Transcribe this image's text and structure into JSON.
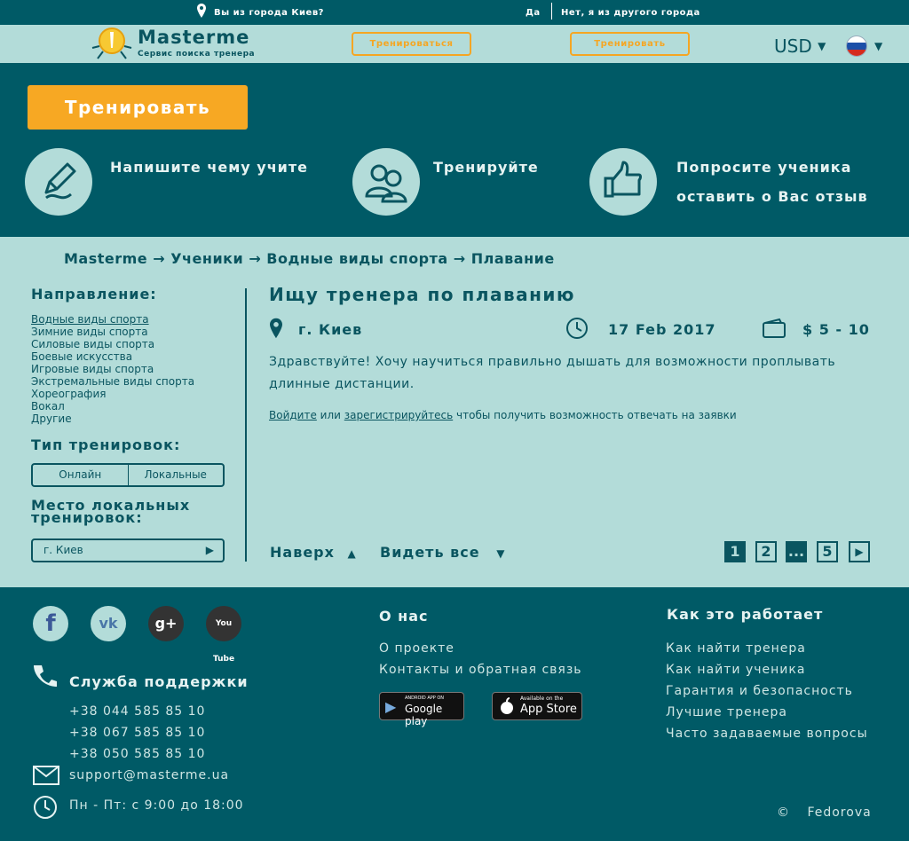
{
  "topbar": {
    "question": "Вы из города Киев?",
    "yes": "Да",
    "no": "Нет, я из другого города"
  },
  "header": {
    "logo_title": "Masterme",
    "logo_subtitle": "Сервис поиска тренера",
    "btn1": "Тренироваться",
    "btn2": "Тренировать",
    "currency": "USD"
  },
  "hero": {
    "cta": "Тренировать",
    "steps": [
      {
        "icon": "pencil-icon",
        "text": "Напишите чему учите"
      },
      {
        "icon": "users-icon",
        "text": "Тренируйте"
      },
      {
        "icon": "thumbs-up-icon",
        "text_line1": "Попросите ученика",
        "text_line2": "оставить о Вас отзыв"
      }
    ]
  },
  "breadcrumb": [
    "Masterme",
    "Ученики",
    "Водные виды спорта",
    "Плавание"
  ],
  "sidebar": {
    "direction_title": "Направление:",
    "directions": [
      "Водные виды спорта",
      "Зимние виды спорта",
      "Силовые виды спорта",
      "Боевые искусства",
      "Игровые виды спорта",
      "Экстремальные виды спорта",
      "Хореография",
      "Вокал",
      "Другие"
    ],
    "type_title": "Тип тренировок:",
    "type_options": [
      "Онлайн",
      "Локальные"
    ],
    "place_title_line1": "Место локальных",
    "place_title_line2": "тренировок:",
    "city_value": "г. Киев"
  },
  "request": {
    "title": "Ищу тренера по плаванию",
    "city": "г. Киев",
    "date": "17 Feb 2017",
    "price": "$ 5 - 10",
    "description": "Здравствуйте! Хочу научиться правильно дышать для возможности проплывать длинные дистанции.",
    "login_link": "Войдите",
    "or": "или",
    "register_link": "зарегистрируйтесь",
    "note_rest": "чтобы получить возможность отвечать на заявки"
  },
  "nav": {
    "up": "Наверх",
    "see_all": "Видеть все",
    "pages": [
      "1",
      "2",
      "...",
      "5"
    ]
  },
  "footer": {
    "support_title": "Служба поддержки",
    "phones": [
      "+38 044 585 85 10",
      "+38 067 585 85 10",
      "+38 050 585 85 10"
    ],
    "email": "support@masterme.ua",
    "hours": "Пн - Пт: с  9:00 до 18:00",
    "about_title": "О нас",
    "about_links": [
      "О проекте",
      "Контакты и обратная связь"
    ],
    "how_title": "Как это работает",
    "how_links": [
      "Как найти тренера",
      "Как найти ученика",
      "Гарантия и безопасность",
      "Лучшие тренера",
      "Часто задаваемые вопросы"
    ],
    "google_play_small": "ANDROID APP ON",
    "google_play": "Google play",
    "app_store_small": "Available on the",
    "app_store": "App Store",
    "copyright_symbol": "©",
    "copyright": "Fedorova"
  },
  "colors": {
    "dark_teal": "#005a66",
    "light_teal": "#b3dcd9",
    "accent_orange": "#f7a823"
  }
}
